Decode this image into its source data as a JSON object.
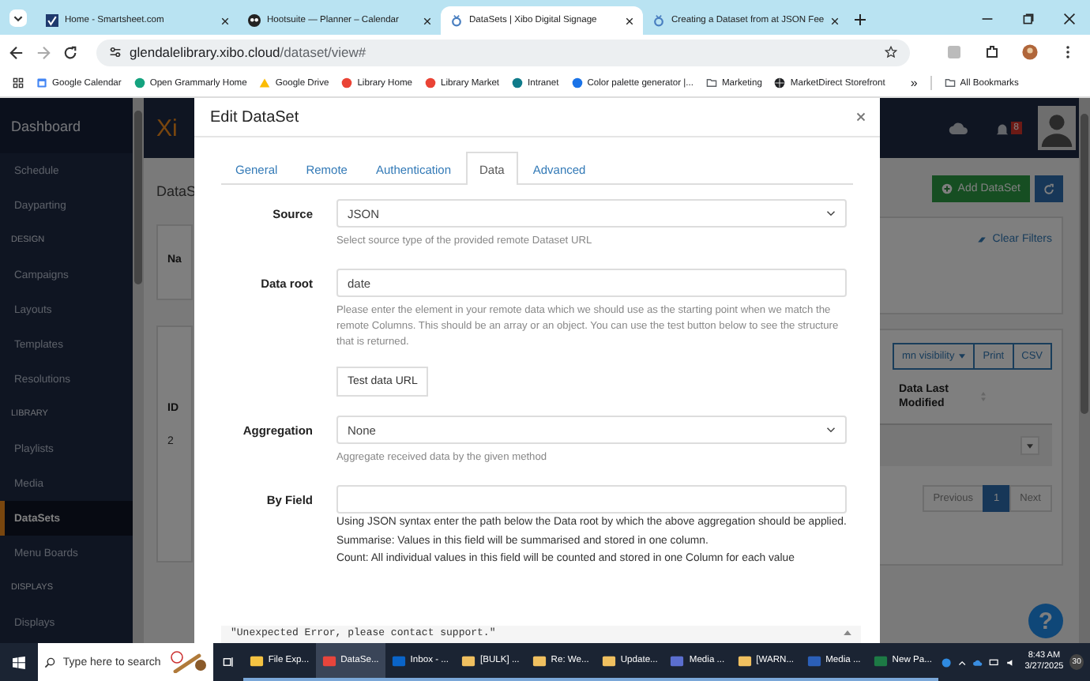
{
  "browser": {
    "tabs": [
      {
        "title": "Home - Smartsheet.com",
        "kind": "check",
        "selected": false
      },
      {
        "title": "Hootsuite — Planner – Calendar",
        "kind": "owl",
        "selected": false
      },
      {
        "title": "DataSets | Xibo Digital Signage",
        "kind": "pin",
        "selected": true
      },
      {
        "title": "Creating a Dataset from at JSON Fee",
        "kind": "pin",
        "selected": false
      }
    ],
    "url_host": "glendalelibrary.xibo.cloud",
    "url_path": "/dataset/view#",
    "bookmarks": [
      {
        "label": "Google Calendar",
        "kind": "calendar",
        "color": "#4285f4"
      },
      {
        "label": "Open Grammarly Home",
        "kind": "circle",
        "color": "#15a37f"
      },
      {
        "label": "Google Drive",
        "kind": "drive",
        "color": "#fbbc04"
      },
      {
        "label": "Library Home",
        "kind": "circle",
        "color": "#ea4335"
      },
      {
        "label": "Library Market",
        "kind": "circle",
        "color": "#ea4335"
      },
      {
        "label": "Intranet",
        "kind": "circle",
        "color": "#0f7b8a"
      },
      {
        "label": "Color palette generator |...",
        "kind": "circle",
        "color": "#1a73e8"
      },
      {
        "label": "Marketing",
        "kind": "folder",
        "color": "#5f6368"
      },
      {
        "label": "MarketDirect Storefront",
        "kind": "globe",
        "color": "#202124"
      }
    ],
    "overflow": "»",
    "all_bookmarks": "All Bookmarks"
  },
  "app": {
    "sidebar": {
      "header": "Dashboard",
      "items": [
        {
          "label": "Schedule",
          "kind": "item",
          "selected": false
        },
        {
          "label": "Dayparting",
          "kind": "item",
          "selected": false
        },
        {
          "label": "DESIGN",
          "kind": "section"
        },
        {
          "label": "Campaigns",
          "kind": "item",
          "selected": false
        },
        {
          "label": "Layouts",
          "kind": "item",
          "selected": false
        },
        {
          "label": "Templates",
          "kind": "item",
          "selected": false
        },
        {
          "label": "Resolutions",
          "kind": "item",
          "selected": false
        },
        {
          "label": "LIBRARY",
          "kind": "section"
        },
        {
          "label": "Playlists",
          "kind": "item",
          "selected": false
        },
        {
          "label": "Media",
          "kind": "item",
          "selected": false
        },
        {
          "label": "DataSets",
          "kind": "item",
          "selected": true
        },
        {
          "label": "Menu Boards",
          "kind": "item",
          "selected": false
        },
        {
          "label": "DISPLAYS",
          "kind": "section"
        },
        {
          "label": "Displays",
          "kind": "item",
          "selected": false
        }
      ]
    },
    "logo": "Xi",
    "notification_count": "8",
    "page_title": "DataS",
    "filter_label": "Na",
    "add_button": "Add DataSet",
    "clear_filters": "Clear Filters",
    "table_buttons": [
      "mn visibility",
      "Print",
      "CSV"
    ],
    "columns": [
      "ID",
      "Data Last Modified"
    ],
    "row_id": "2",
    "pagination": [
      {
        "label": "Previous",
        "selected": false
      },
      {
        "label": "1",
        "selected": true
      },
      {
        "label": "Next",
        "selected": false
      }
    ],
    "help": "?"
  },
  "modal": {
    "title": "Edit DataSet",
    "tabs": [
      {
        "label": "General",
        "selected": false
      },
      {
        "label": "Remote",
        "selected": false
      },
      {
        "label": "Authentication",
        "selected": false
      },
      {
        "label": "Data",
        "selected": true
      },
      {
        "label": "Advanced",
        "selected": false
      }
    ],
    "fields": [
      {
        "kind": "select",
        "label": "Source",
        "value": "JSON",
        "hint": "Select source type of the provided remote Dataset URL"
      },
      {
        "kind": "text",
        "label": "Data root",
        "value": "date",
        "hint": "Please enter the element in your remote data which we should use as the starting point when we match the remote Columns. This should be an array or an object. You can use the test button below to see the structure that is returned."
      },
      {
        "kind": "button",
        "label": "Test data URL"
      },
      {
        "kind": "select",
        "label": "Aggregation",
        "value": "None",
        "hint": "Aggregate received data by the given method"
      },
      {
        "kind": "text",
        "label": "By Field",
        "help": [
          "Using JSON syntax enter the path below the Data root by which the above aggregation should be applied.",
          "Summarise: Values in this field will be summarised and stored in one column.",
          "Count: All individual values in this field will be counted and stored in one Column for each value"
        ]
      }
    ],
    "error": "\"Unexpected Error, please contact support.\""
  },
  "taskbar": {
    "search_placeholder": "Type here to search",
    "apps": [
      {
        "label": "File Exp...",
        "kind": "folder",
        "selected": false
      },
      {
        "label": "DataSe...",
        "kind": "browser",
        "selected": true
      },
      {
        "label": "Inbox - ...",
        "kind": "outlook",
        "selected": false
      },
      {
        "label": "[BULK] ...",
        "kind": "mail",
        "selected": false
      },
      {
        "label": "Re: We...",
        "kind": "mail",
        "selected": false
      },
      {
        "label": "Update...",
        "kind": "mail",
        "selected": false
      },
      {
        "label": "Media ...",
        "kind": "teams",
        "selected": false
      },
      {
        "label": "[WARN...",
        "kind": "mail",
        "selected": false
      },
      {
        "label": "Media ...",
        "kind": "word",
        "selected": false
      },
      {
        "label": "New Pa...",
        "kind": "excel",
        "selected": false
      }
    ],
    "time": "8:43 AM",
    "date": "3/27/2025",
    "notification_count": "30"
  }
}
